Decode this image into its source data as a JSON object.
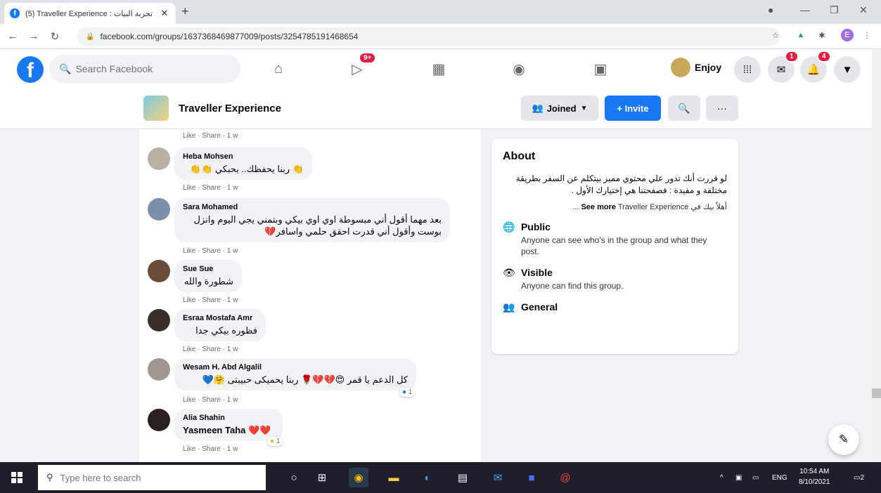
{
  "browser": {
    "tab_title": "(5) Traveller Experience : تجربة البيات",
    "tab_close": "✕",
    "new_tab": "+",
    "url": "facebook.com/groups/1637368469877009/posts/3254785191468654"
  },
  "fb": {
    "search_placeholder": "Search Facebook",
    "badges": {
      "watch": "9+",
      "messenger": "1",
      "notifications": "4"
    },
    "profile_name": "Enjoy"
  },
  "group": {
    "name": "Traveller Experience",
    "joined_label": "Joined",
    "invite_label": "+ Invite",
    "more_label": "···"
  },
  "feed": {
    "prev_actions": "Like · Share · 1 w",
    "comments": [
      {
        "name": "Heba Mohsen",
        "text": "👏 ربنا يحفظك.. بحبكي 👏👏",
        "actions": "Like · Share · 1 w",
        "avatar_color": "#b8b0a0"
      },
      {
        "name": "Sara Mohamed",
        "text": "بعد مهما أقول أني مبسوطة اوي اوي بيكي وبتمني يجي اليوم وانزل بوست وأقول أني قدرت احقق حلمي واسافر💔",
        "actions": "Like · Share · 1 w",
        "avatar_color": "#7a8fa8"
      },
      {
        "name": "Sue Sue",
        "text": "شطورة والله",
        "actions": "Like · Share · 1 w",
        "avatar_color": "#6a4e3a"
      },
      {
        "name": "Esraa Mostafa Amr",
        "text": "فظوره بيكي جدا",
        "actions": "Like · Share · 1 w",
        "avatar_color": "#3a2e28"
      },
      {
        "name": "Wesam H. Abd Algalil",
        "text": "كل الدعم يا قمر 😍💔💔🌹 ربنا يحميكى حبيبتى 🤗💙",
        "actions": "Like · Share · 1 w",
        "avatar_color": "#a09890",
        "reaction": "1"
      },
      {
        "name": "Alia Shahin",
        "text": "Yasmeen Taha ❤️❤️",
        "actions": "Like · Share · 1 w",
        "avatar_color": "#2a2020",
        "reaction": "1"
      }
    ]
  },
  "about": {
    "title": "About",
    "description": "لو قررت أنك تدور علي محتوي مميز بيتكلم عن السفر بطريقة مختلفة و مفيدة : فصفحتنا هي إختيارك الأول .",
    "see_more_prefix": "أهلاً بيك في",
    "see_more_group": "Traveller Experience ...",
    "see_more_label": "See more",
    "public_title": "Public",
    "public_sub": "Anyone can see who's in the group and what they post.",
    "visible_title": "Visible",
    "visible_sub": "Anyone can find this group.",
    "general_title": "General"
  },
  "taskbar": {
    "search_placeholder": "Type here to search",
    "lang": "ENG",
    "time": "10:54 AM",
    "date": "8/10/2021",
    "notif": "2"
  }
}
